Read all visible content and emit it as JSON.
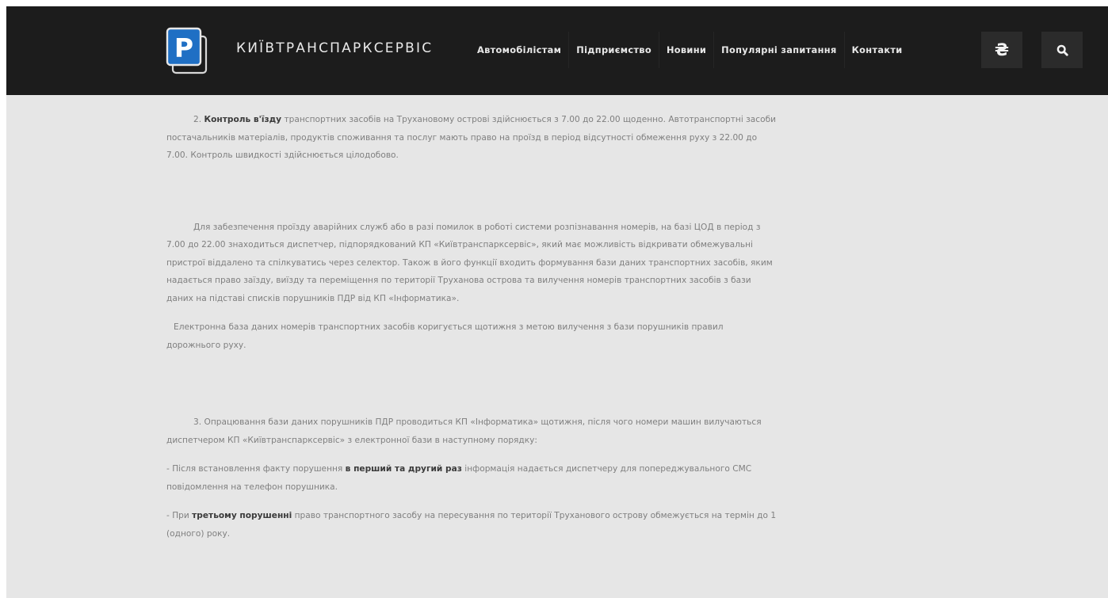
{
  "header": {
    "brand_name": "КИЇВТРАНСПАРКСЕРВІС",
    "logo_letter": "P",
    "logo_icon": "parking-logo-icon",
    "nav": [
      {
        "label": "Автомобілістам"
      },
      {
        "label": "Підприємство"
      },
      {
        "label": "Новини"
      },
      {
        "label": "Популярні запитання"
      },
      {
        "label": "Контакти"
      }
    ],
    "currency_symbol": "₴",
    "search_icon": "search-icon"
  },
  "colors": {
    "header_bg": "#1c1c1c",
    "page_bg": "#e6e6e6",
    "logo_blue": "#1f6fc4",
    "body_text": "#7f7f7f",
    "bold_text": "#3a3a3a"
  },
  "content": {
    "p1": {
      "pre": "2. ",
      "bold": "Контроль в'їзду",
      "post": " транспортних засобів на Трухановому острові здійснюється з 7.00 до 22.00 щоденно. Автотранспортні засоби постачальників матеріалів, продуктів споживання та послуг мають право на проїзд в період відсутності обмеження руху з 22.00 до 7.00. Контроль швидкості здійснюється цілодобово."
    },
    "p2": "Для забезпечення проїзду аварійних служб або в разі помилок в роботі системи розпізнавання номерів, на базі ЦОД в період з 7.00 до 22.00 знаходиться диспетчер, підпорядкований КП «Київтранспарксервіс», який має можливість відкривати обмежувальні пристрої віддалено та спілкуватись через селектор. Також в його функції входить формування бази даних транспортних засобів, яким надається право заїзду, виїзду та переміщення по території Труханова острова та вилучення номерів транспортних засобів з бази даних на підставі списків порушників ПДР від КП «Інформатика».",
    "p3": "Електронна база даних номерів транспортних засобів коригується щотижня з метою вилучення з бази порушників правил дорожнього руху.",
    "p4": "3. Опрацювання бази даних порушників ПДР проводиться КП «Інформатика» щотижня, після чого номери машин вилучаються диспетчером КП «Київтранспарксервіс» з електронної бази в наступному порядку:",
    "p5": {
      "pre": "- Після встановлення факту порушення ",
      "bold": "в перший та другий раз",
      "post": " інформація надається диспетчеру для попереджувального СМС повідомлення на телефон порушника."
    },
    "p6": {
      "pre": "- При ",
      "bold": "третьому порушенні",
      "post": " право транспортного засобу на пересування по території Труханового острову обмежується на термін до 1 (одного) року."
    }
  }
}
